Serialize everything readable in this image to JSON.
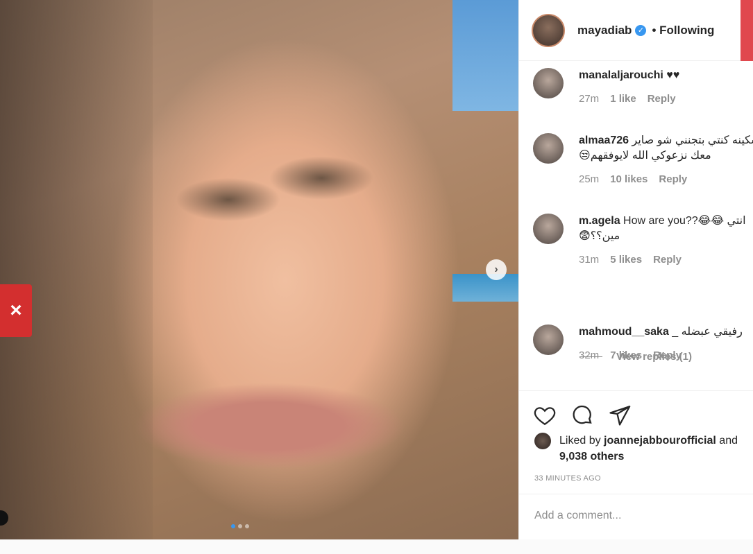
{
  "header": {
    "username": "mayadiab",
    "verified_icon": "verified-check-icon",
    "separator": "•",
    "following_label": "Following"
  },
  "photo": {
    "carousel_dots": 3,
    "active_dot": 0
  },
  "comments": [
    {
      "user": "manalaljarouchi",
      "text": "♥♥",
      "text2": "",
      "time": "27m",
      "likes": "1 like",
      "reply": "Reply"
    },
    {
      "user": "almaa726",
      "text": "سكينه كنتي بتجنني شو صاير",
      "text2": "😒معك نزعوكي الله لايوفقهم",
      "time": "25m",
      "likes": "10 likes",
      "reply": "Reply"
    },
    {
      "user": "m.agela",
      "text": "How are you??😂😂 انتي",
      "text2": "😨مين؟؟",
      "time": "31m",
      "likes": "5 likes",
      "reply": "Reply"
    },
    {
      "user": "mahmoud__saka",
      "text": "_ رفيقي عبضله",
      "text2": "",
      "time": "32m",
      "likes": "7 likes",
      "reply": "Reply"
    }
  ],
  "view_replies": "View replies (1)",
  "liked_by": {
    "prefix": "Liked by ",
    "user": "joannejabbourofficial",
    "suffix": " and",
    "others": "9,038 others"
  },
  "timestamp": "33 MINUTES AGO",
  "add_comment_placeholder": "Add a comment...",
  "icons": {
    "like": "heart-icon",
    "comment": "comment-bubble-icon",
    "share": "send-icon",
    "next": "chevron-right-icon"
  },
  "colors": {
    "accent": "#3897f0",
    "close_red": "#d32f2f",
    "muted": "#8e8e8e"
  }
}
